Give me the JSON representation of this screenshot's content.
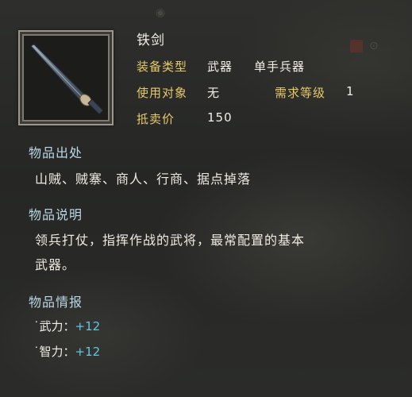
{
  "item": {
    "name": "铁剑",
    "icon": "iron-sword-icon"
  },
  "attributes": {
    "equip_type_label": "装备类型",
    "equip_type_value": "武器",
    "equip_subtype_value": "单手兵器",
    "target_label": "使用对象",
    "target_value": "无",
    "level_req_label": "需求等级",
    "level_req_value": "1",
    "price_label": "抵卖价",
    "price_value": "150"
  },
  "source": {
    "title": "物品出处",
    "text": "山贼、贼寨、商人、行商、据点掉落"
  },
  "description": {
    "title": "物品说明",
    "line1": "领兵打仗，指挥作战的武将，最常配置的基本",
    "line2": "武器。"
  },
  "intel": {
    "title": "物品情报",
    "stats": [
      {
        "label": "˙武力：",
        "value": "+12"
      },
      {
        "label": "˙智力：",
        "value": "+12"
      }
    ]
  },
  "colors": {
    "label_gold": "#e6c86a",
    "section_blue": "#b9d8e6",
    "stat_cyan": "#5fc7e6"
  }
}
